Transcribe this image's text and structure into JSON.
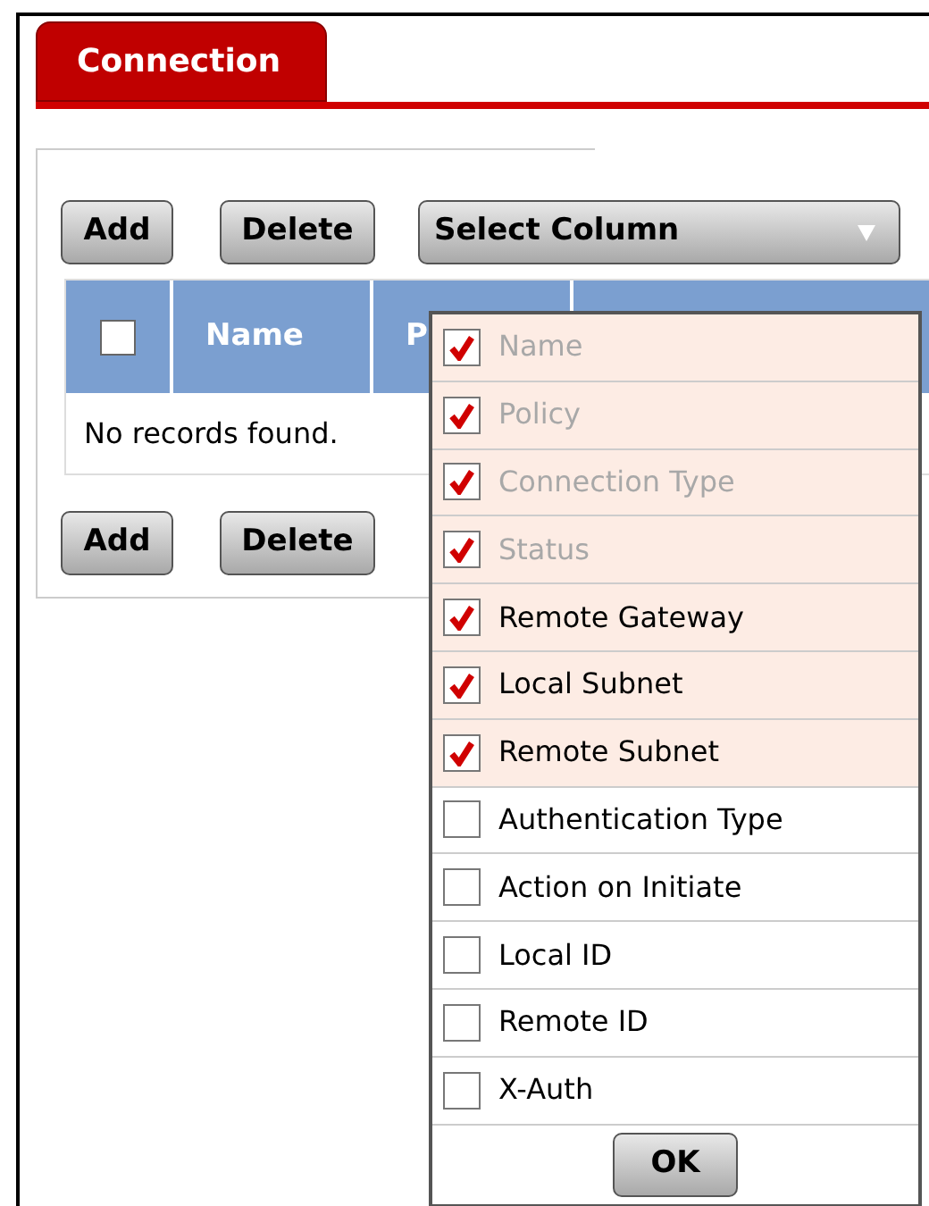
{
  "tabs": [
    {
      "label": "Connection",
      "selected": true
    }
  ],
  "toolbar_top": {
    "add": "Add",
    "delete": "Delete",
    "select_column": "Select Column"
  },
  "table": {
    "header_checkbox": {
      "checked": false
    },
    "columns": [
      "Name",
      "P"
    ],
    "empty_message": "No records found."
  },
  "toolbar_bottom": {
    "add": "Add",
    "delete": "Delete"
  },
  "column_menu": {
    "items": [
      {
        "label": "Name",
        "checked": true,
        "disabled": true
      },
      {
        "label": "Policy",
        "checked": true,
        "disabled": true
      },
      {
        "label": "Connection Type",
        "checked": true,
        "disabled": true
      },
      {
        "label": "Status",
        "checked": true,
        "disabled": true
      },
      {
        "label": "Remote Gateway",
        "checked": true,
        "disabled": false
      },
      {
        "label": "Local Subnet",
        "checked": true,
        "disabled": false
      },
      {
        "label": "Remote Subnet",
        "checked": true,
        "disabled": false
      },
      {
        "label": "Authentication Type",
        "checked": false,
        "disabled": false
      },
      {
        "label": "Action on Initiate",
        "checked": false,
        "disabled": false
      },
      {
        "label": "Local ID",
        "checked": false,
        "disabled": false
      },
      {
        "label": "Remote ID",
        "checked": false,
        "disabled": false
      },
      {
        "label": "X-Auth",
        "checked": false,
        "disabled": false
      }
    ],
    "ok": "OK"
  }
}
